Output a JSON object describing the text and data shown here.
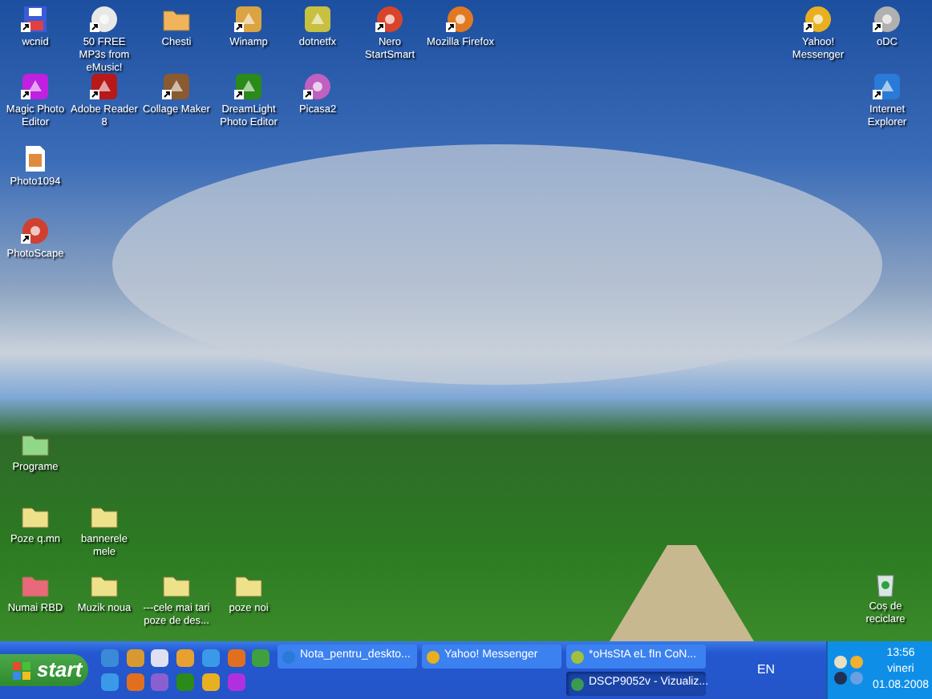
{
  "desktop_icons": [
    {
      "label": "wcnid",
      "kind": "disk",
      "color": "#3b5bd8",
      "shortcut": true
    },
    {
      "label": "50 FREE MP3s from eMusic!",
      "kind": "disc",
      "color": "#e8e8e8",
      "shortcut": true
    },
    {
      "label": "Chesti",
      "kind": "folder",
      "color": "#f2b45a",
      "shortcut": false
    },
    {
      "label": "Winamp",
      "kind": "app",
      "color": "#d9a441",
      "shortcut": true
    },
    {
      "label": "dotnetfx",
      "kind": "app",
      "color": "#c8c040",
      "shortcut": false
    },
    {
      "label": "Nero StartSmart",
      "kind": "disc",
      "color": "#d8442a",
      "shortcut": true
    },
    {
      "label": "Mozilla Firefox",
      "kind": "disc",
      "color": "#e07a22",
      "shortcut": true
    },
    {
      "label": "Magic Photo Editor",
      "kind": "app",
      "color": "#c020e0",
      "shortcut": true
    },
    {
      "label": "Adobe Reader 8",
      "kind": "app",
      "color": "#b81818",
      "shortcut": true
    },
    {
      "label": "Collage Maker",
      "kind": "app",
      "color": "#8a5a30",
      "shortcut": true
    },
    {
      "label": "DreamLight Photo Editor",
      "kind": "app",
      "color": "#2a8a1a",
      "shortcut": true
    },
    {
      "label": "Picasa2",
      "kind": "disc",
      "color": "#c060c0",
      "shortcut": true
    },
    {
      "label": "Photo1094",
      "kind": "document",
      "color": "#e08a40",
      "shortcut": false
    },
    {
      "label": "PhotoScape",
      "kind": "disc",
      "color": "#d04030",
      "shortcut": true
    },
    {
      "label": "Yahoo! Messenger",
      "kind": "disc",
      "color": "#e8b020",
      "shortcut": true
    },
    {
      "label": "oDC",
      "kind": "disc",
      "color": "#b0b0b0",
      "shortcut": true
    },
    {
      "label": "Internet Explorer",
      "kind": "app",
      "color": "#2a7ad8",
      "shortcut": true
    },
    {
      "label": "Programe",
      "kind": "folder",
      "color": "#8fd88a",
      "shortcut": false
    },
    {
      "label": "Poze q.mn",
      "kind": "folder",
      "color": "#ede28a",
      "shortcut": false
    },
    {
      "label": "bannerele mele",
      "kind": "folder",
      "color": "#ede28a",
      "shortcut": false
    },
    {
      "label": "Numai RBD",
      "kind": "folder",
      "color": "#e86a7a",
      "shortcut": false
    },
    {
      "label": "Muzik noua",
      "kind": "folder",
      "color": "#ede28a",
      "shortcut": false
    },
    {
      "label": "---cele mai tari poze de des...",
      "kind": "folder",
      "color": "#ede28a",
      "shortcut": false
    },
    {
      "label": "poze noi",
      "kind": "folder",
      "color": "#ede28a",
      "shortcut": false
    },
    {
      "label": "Coș de reciclare",
      "kind": "recycle-bin",
      "color": "#d8e8e0",
      "shortcut": false
    }
  ],
  "taskbar": {
    "start": "start",
    "quick_launch": [
      {
        "color": "#3a8ad8"
      },
      {
        "color": "#d89a30"
      },
      {
        "color": "#e0e0f0"
      },
      {
        "color": "#e8a030"
      },
      {
        "color": "#3a9ae8"
      },
      {
        "color": "#e07020"
      },
      {
        "color": "#40a040"
      },
      {
        "color": "#3a9ae8"
      },
      {
        "color": "#e07020"
      },
      {
        "color": "#8a60d0"
      },
      {
        "color": "#2a8a1a"
      },
      {
        "color": "#e8b020"
      },
      {
        "color": "#b030e0"
      }
    ],
    "button_rows": [
      [
        {
          "label": "Nota_pentru_deskto...",
          "kind": "browser",
          "selected": false
        },
        {
          "label": "Yahoo! Messenger",
          "kind": "messenger",
          "selected": false
        },
        {
          "label": "*oHsStA eL fIn CoN...",
          "kind": "chat",
          "selected": false
        }
      ],
      [
        {
          "label": "DSCP9052v - Vizualiz...",
          "kind": "image-viewer",
          "selected": true
        }
      ]
    ],
    "language": "EN",
    "clock": {
      "time": "13:56",
      "day": "vineri",
      "date": "01.08.2008"
    }
  }
}
